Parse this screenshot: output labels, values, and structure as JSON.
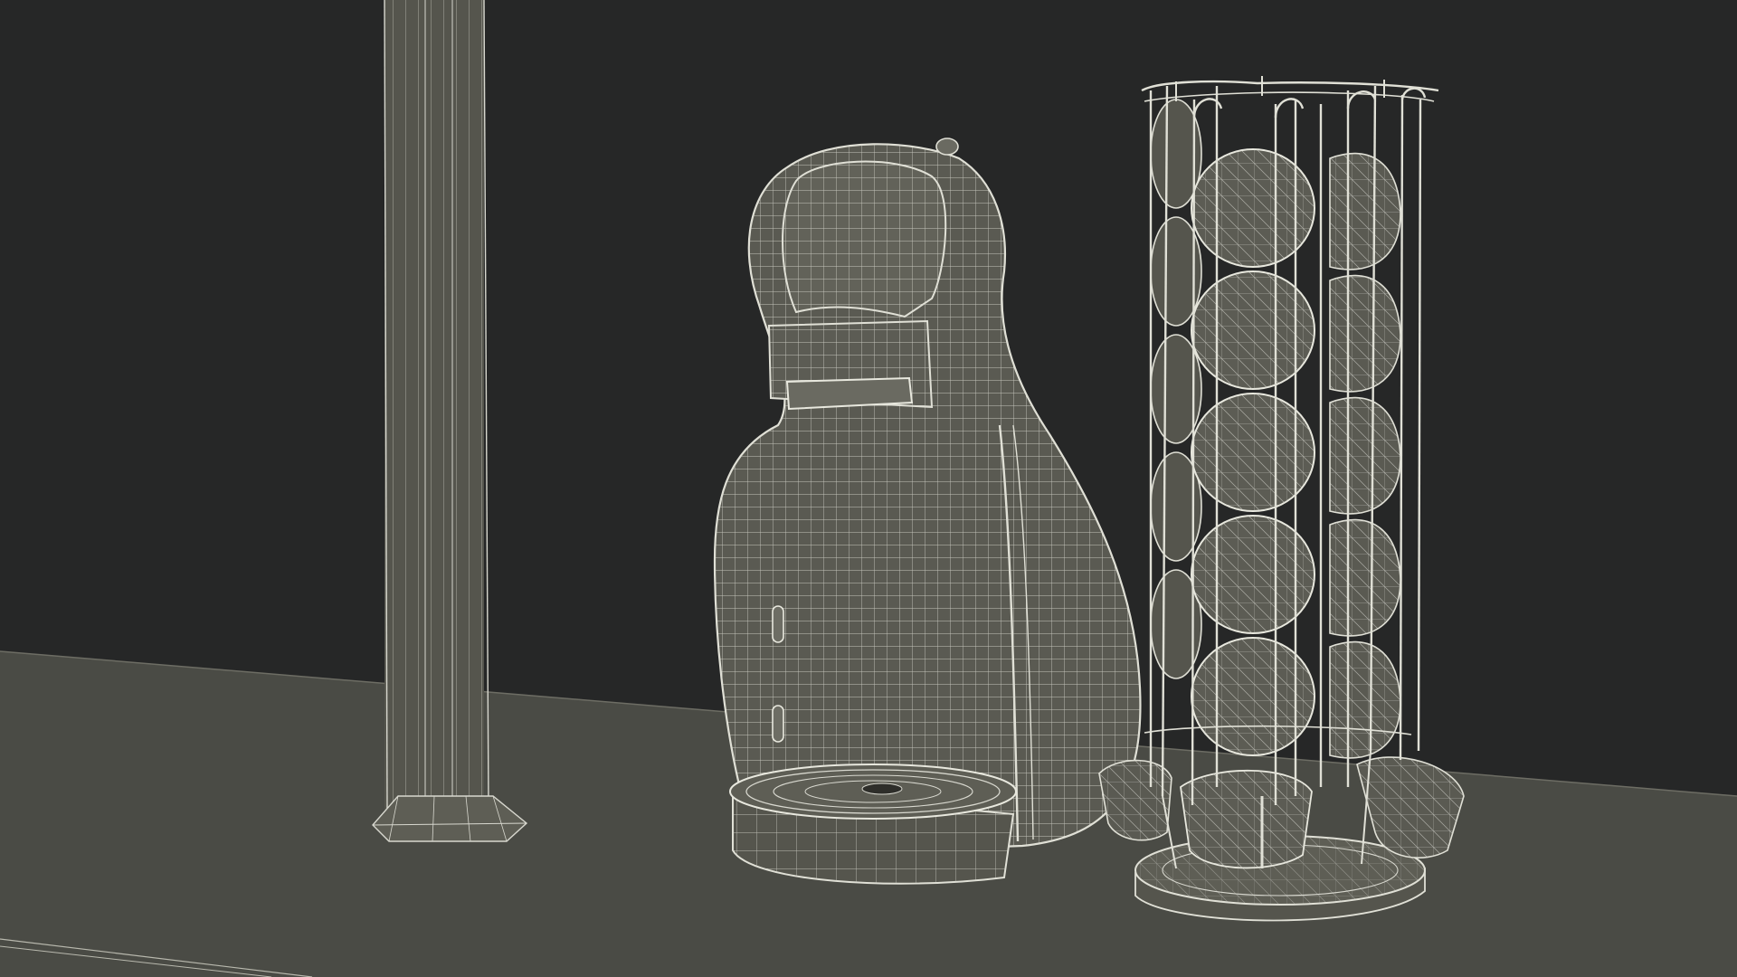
{
  "scene": {
    "description_visible_text": "",
    "render_style": "wireframe",
    "colors": {
      "background_wall": "#262727",
      "floor": "#4a4b45",
      "floor_dark": "#42433e",
      "model_fill": "#5a5a52",
      "model_fill_dark": "#4b4b44",
      "wire": "#d8d8cf",
      "wire_dim": "#a9a99f"
    },
    "objects": [
      {
        "name": "column-pillar"
      },
      {
        "name": "coffee-capsule-machine"
      },
      {
        "name": "rotating-capsule-rack"
      }
    ]
  }
}
